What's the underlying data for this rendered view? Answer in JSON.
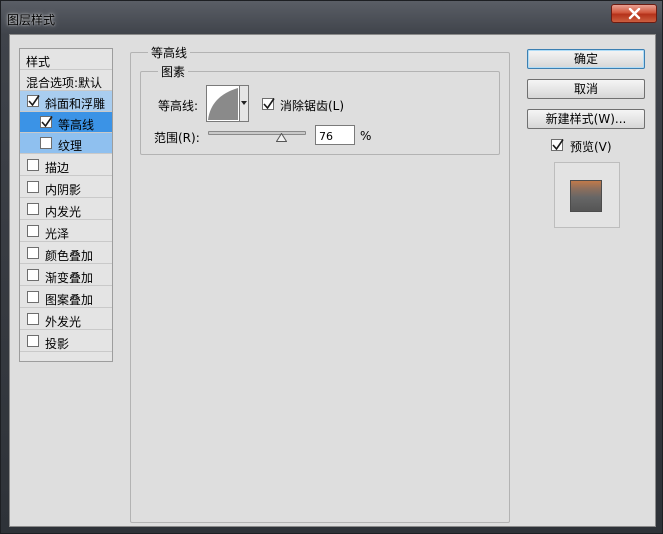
{
  "window": {
    "title": "图层样式"
  },
  "style_list": {
    "header": "样式",
    "blend_options": "混合选项:默认",
    "items": [
      {
        "label": "斜面和浮雕",
        "checked": true
      },
      {
        "label": "等高线",
        "checked": true
      },
      {
        "label": "纹理",
        "checked": false
      },
      {
        "label": "描边",
        "checked": false
      },
      {
        "label": "内阴影",
        "checked": false
      },
      {
        "label": "内发光",
        "checked": false
      },
      {
        "label": "光泽",
        "checked": false
      },
      {
        "label": "颜色叠加",
        "checked": false
      },
      {
        "label": "渐变叠加",
        "checked": false
      },
      {
        "label": "图案叠加",
        "checked": false
      },
      {
        "label": "外发光",
        "checked": false
      },
      {
        "label": "投影",
        "checked": false
      }
    ]
  },
  "contour_panel": {
    "group_title": "等高线",
    "subgroup_title": "图素",
    "contour_label": "等高线:",
    "antialias_label": "消除锯齿(L)",
    "antialias_checked": true,
    "range_label": "范围(R):",
    "range_value": "76",
    "range_percent": 76,
    "range_unit": "%"
  },
  "buttons": {
    "ok": "确定",
    "cancel": "取消",
    "new_style": "新建样式(W)...",
    "preview_label": "预览(V)",
    "preview_checked": true
  },
  "colors": {
    "selection_light": "#a9cdef",
    "selection_dark": "#3b93e6",
    "close_button": "#c7472d",
    "dialog_bg": "#dedede"
  }
}
